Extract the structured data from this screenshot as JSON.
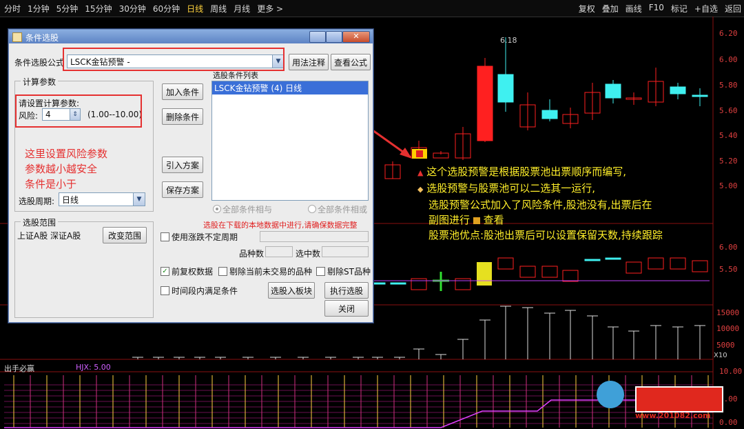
{
  "toolbar": {
    "periods": [
      "分时",
      "1分钟",
      "5分钟",
      "15分钟",
      "30分钟",
      "60分钟",
      "日线",
      "周线",
      "月线",
      "更多 >"
    ],
    "active_period": "日线",
    "right_items": [
      "复权",
      "叠加",
      "画线",
      "F10",
      "标记",
      "+自选",
      "返回"
    ]
  },
  "price_axis": [
    "6.20",
    "6.00",
    "5.80",
    "5.60",
    "5.40",
    "5.20",
    "5.00"
  ],
  "high_marker": "6.18",
  "indicator_axis": [
    "6.00",
    "5.50"
  ],
  "volume_axis": [
    "15000",
    "10000",
    "5000"
  ],
  "volume_unit": "X10",
  "bottom_panel": {
    "title": "出手必赢",
    "value": "HJX: 5.00",
    "axis": [
      "10.00",
      "5.00",
      "0.00"
    ]
  },
  "dialog": {
    "title": "条件选股",
    "formula_label": "条件选股公式",
    "formula_value": "LSCK金钻预警 -",
    "usage_btn": "用法注释",
    "view_formula_btn": "查看公式",
    "params_group": "计算参数",
    "params_prompt": "请设置计算参数:",
    "risk_label": "风险:",
    "risk_value": "4",
    "risk_range": "(1.00--10.00)",
    "add_condition": "加入条件",
    "delete_condition": "删除条件",
    "import_plan": "引入方案",
    "save_plan": "保存方案",
    "conditions_label": "选股条件列表",
    "conditions": [
      "LSCK金钻预警 (4) 日线"
    ],
    "period_label": "选股周期:",
    "period_value": "日线",
    "radio_and": "全部条件相与",
    "radio_or": "全部条件相或",
    "range_group": "选股范围",
    "range_value": "上证A股 深证A股",
    "change_range": "改变范围",
    "warning": "选股在下载的本地数据中进行,请确保数据完整",
    "use_uncertain": "使用涨跌不定周期",
    "variety_count": "品种数",
    "selected_count": "选中数",
    "pre_restore": "前复权数据",
    "exclude_untraded": "剔除当前未交易的品种",
    "exclude_st": "剔除ST品种",
    "time_segment": "时间段内满足条件",
    "to_board": "选股入板块",
    "execute": "执行选股",
    "close": "关闭"
  },
  "annotation_left": [
    "这里设置风险参数",
    "参数越小越安全",
    "条件是小于"
  ],
  "annotation_right": [
    "这个选股预警是根据股票池出票顺序而编写,",
    "选股预警与股票池可以二选其一运行,",
    "选股预警公式加入了风险条件,股池没有,出票后在",
    "副图进行",
    "查看",
    "股票池优点:股池出票后可以设置保留天数,持续跟踪"
  ],
  "watermark": "www.201082.com",
  "colors": {
    "up": "#ff2020",
    "down": "#3ff0f0",
    "annotation": "#ffef2a",
    "highlight_red": "#e53030"
  }
}
